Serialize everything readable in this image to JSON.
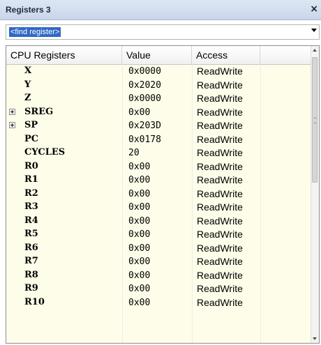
{
  "window": {
    "title": "Registers 3",
    "close_glyph": "×"
  },
  "find": {
    "text": "<find register>"
  },
  "table": {
    "columns": [
      "CPU Registers",
      "Value",
      "Access"
    ],
    "rows": [
      {
        "name": "X",
        "value": "0x0000",
        "access": "ReadWrite",
        "expandable": false
      },
      {
        "name": "Y",
        "value": "0x2020",
        "access": "ReadWrite",
        "expandable": false
      },
      {
        "name": "Z",
        "value": "0x0000",
        "access": "ReadWrite",
        "expandable": false
      },
      {
        "name": "SREG",
        "value": "0x00",
        "access": "ReadWrite",
        "expandable": true
      },
      {
        "name": "SP",
        "value": "0x203D",
        "access": "ReadWrite",
        "expandable": true
      },
      {
        "name": "PC",
        "value": "0x0178",
        "access": "ReadWrite",
        "expandable": false
      },
      {
        "name": "CYCLES",
        "value": "20",
        "access": "ReadWrite",
        "expandable": false
      },
      {
        "name": "R0",
        "value": "0x00",
        "access": "ReadWrite",
        "expandable": false
      },
      {
        "name": "R1",
        "value": "0x00",
        "access": "ReadWrite",
        "expandable": false
      },
      {
        "name": "R2",
        "value": "0x00",
        "access": "ReadWrite",
        "expandable": false
      },
      {
        "name": "R3",
        "value": "0x00",
        "access": "ReadWrite",
        "expandable": false
      },
      {
        "name": "R4",
        "value": "0x00",
        "access": "ReadWrite",
        "expandable": false
      },
      {
        "name": "R5",
        "value": "0x00",
        "access": "ReadWrite",
        "expandable": false
      },
      {
        "name": "R6",
        "value": "0x00",
        "access": "ReadWrite",
        "expandable": false
      },
      {
        "name": "R7",
        "value": "0x00",
        "access": "ReadWrite",
        "expandable": false
      },
      {
        "name": "R8",
        "value": "0x00",
        "access": "ReadWrite",
        "expandable": false
      },
      {
        "name": "R9",
        "value": "0x00",
        "access": "ReadWrite",
        "expandable": false
      },
      {
        "name": "R10",
        "value": "0x00",
        "access": "ReadWrite",
        "expandable": false
      }
    ]
  },
  "colors": {
    "title_bg": "#c9d6ea",
    "grid_bg": "#fdfde9",
    "find_highlight": "#3168c5"
  }
}
